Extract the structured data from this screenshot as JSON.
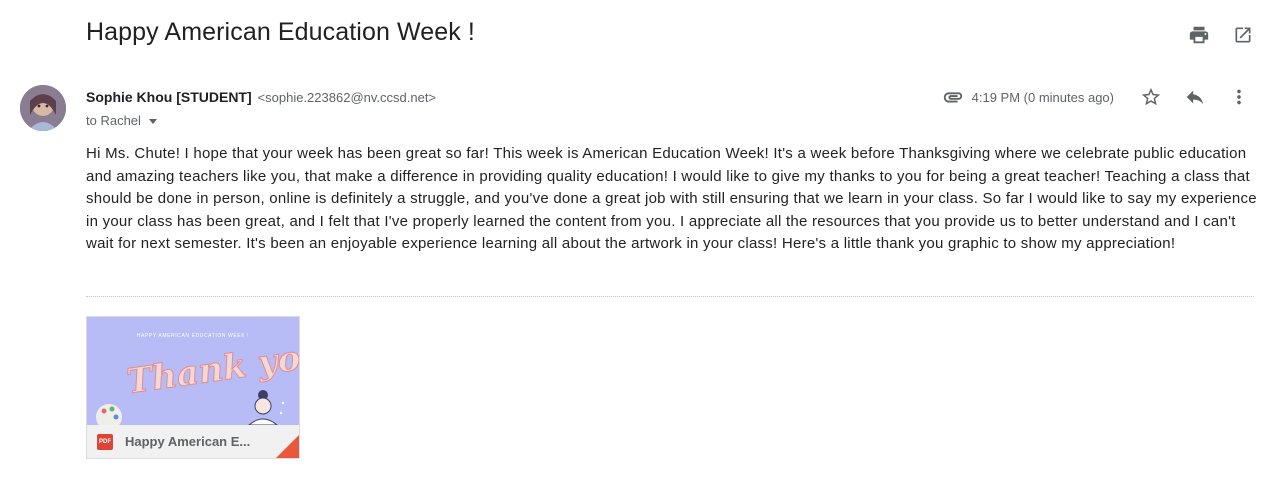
{
  "subject": "Happy American Education Week !",
  "header_icons": {
    "print": "print-icon",
    "open_new_window": "open-in-new-window-icon"
  },
  "sender": {
    "name": "Sophie Khou [STUDENT]",
    "email": "<sophie.223862@nv.ccsd.net>",
    "to": "to Rachel"
  },
  "meta": {
    "time": "4:19 PM (0 minutes ago)",
    "icons": [
      "attachment-icon",
      "star-icon",
      "reply-icon",
      "more-vertical-icon"
    ]
  },
  "body": "Hi Ms. Chute! I hope that your week has been great so far! This week is American Education Week! It's a week before Thanksgiving where we celebrate public education and amazing teachers like you, that make a difference in providing quality education! I would like to give my thanks to you for being a great teacher! Teaching a class that should be done in person, online is definitely a struggle, and you've done a great job with still ensuring that we learn in your class. So far I would like to say my experience in your class has been great, and I felt that I've properly learned the content from you. I appreciate all the resources that you provide us to better understand and I can't wait for next semester. It's been an enjoyable experience learning all about the artwork in your class! Here's a little thank you graphic to show my appreciation!",
  "attachment": {
    "thumbnail_caption": "HAPPY AMERICAN EDUCATION WEEK !",
    "thumbnail_text": "Thank you!",
    "type_badge": "PDF",
    "name": "Happy American E...",
    "colors": {
      "thumbnail_bg": "#b7bbf6",
      "pdf_red": "#db4437",
      "fold": "#e8593b"
    }
  }
}
